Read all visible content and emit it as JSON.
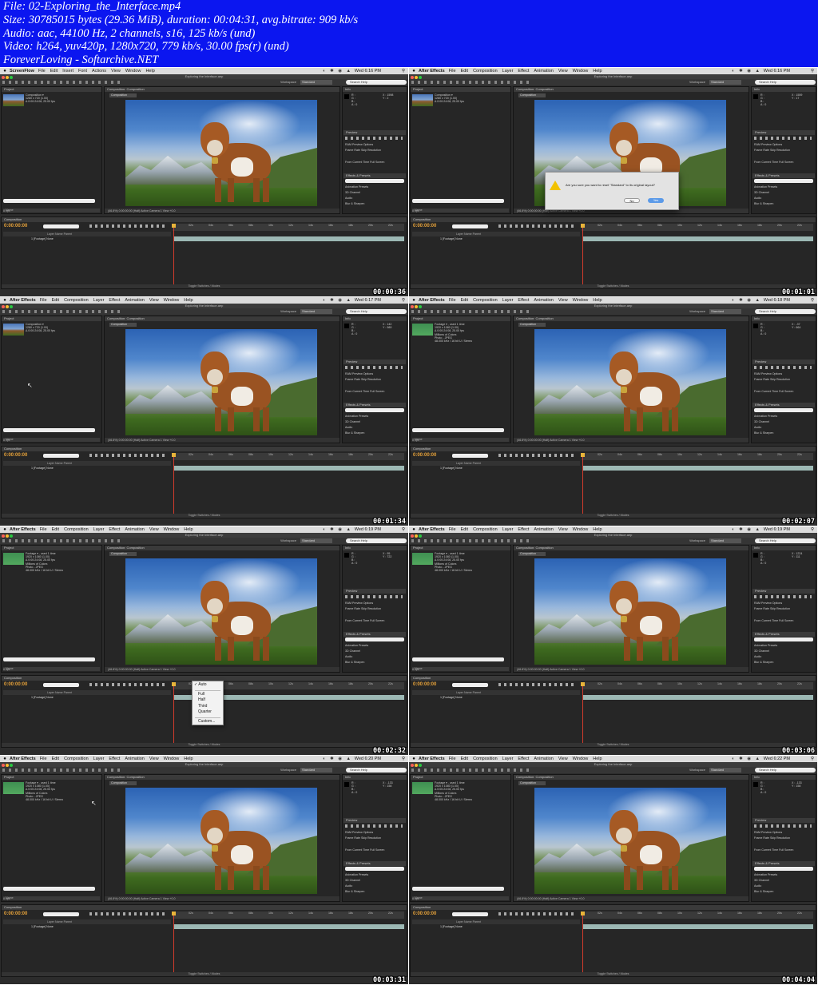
{
  "header": {
    "lines": [
      "File: 02-Exploring_the_Interface.mp4",
      "Size: 30785015 bytes (29.36 MiB), duration: 00:04:31, avg.bitrate: 909 kb/s",
      "Audio: aac, 44100 Hz, 2 channels, s16, 125 kb/s (und)",
      "Video: h264, yuv420p, 1280x720, 779 kb/s, 30.00 fps(r) (und)",
      "ForeverLoving - Softarchive.NET"
    ]
  },
  "colors": {
    "header_bg": "#0b16f0",
    "timecode": "#e8a33a",
    "playhead": "#d23b2c",
    "layer_bar": "#9cb8b4"
  },
  "common": {
    "window_title": "Exploring the Interface.aep",
    "workspace_label": "Workspace",
    "workspace_value": "Standard",
    "search_help": "Search Help",
    "project_tab": "Project",
    "composition_tab": "Composition: Composition",
    "comp_subtab": "Composition",
    "info_tab": "Info",
    "audio_tab": "Audio",
    "preview_tab": "Preview",
    "ram_preview": "RAM Preview Options",
    "frame_rate_line": "Frame Rate  Skip  Resolution",
    "from_current": "From Current Time   Full Screen",
    "effects_tab": "Effects & Presets",
    "effects_items": [
      "Animation Presets",
      "3D Channel",
      "Audio",
      "Blur & Sharpen"
    ],
    "name_col": "Name",
    "project_items": [
      "Composition",
      "Footage"
    ],
    "project_bottom": "8 bpc",
    "comp_footer": "(46.8%)   0:00:00:00   (Half)   Active Camera   1 View   +0.0",
    "timeline_tab": "Composition",
    "timecode": "0:00:00:00",
    "ruler_ticks": [
      "02s",
      "04s",
      "06s",
      "08s",
      "10s",
      "12s",
      "14s",
      "16s",
      "18s",
      "20s",
      "22s"
    ],
    "layer_header": "Layer Name          Parent",
    "layer_row": "1   [Footage]                None",
    "timeline_footer": "Toggle Switches / Modes",
    "rgb": "R :\nG :\nB :\nA : 0",
    "comp_info": "Composition ▾\n1280 x 720 (1.00)\nΔ 0:00:24:08, 25.00 fps",
    "footage_info": "Footage ▾ , used 1 time\n1920 x 1080 (1.00)\nΔ 0:00:24:08, 25.00 fps\nMillions of Colors\nPhoto - JPEG\n48.000 kHz / 16 bit U / Stereo"
  },
  "frames": [
    {
      "timestamp": "00:00:36",
      "app": "ScreenFlow",
      "menus": [
        "File",
        "Edit",
        "Insert",
        "Font",
        "Actions",
        "View",
        "Window",
        "Help"
      ],
      "clock": "Wed 6:16 PM",
      "info": "comp",
      "xy": "X : 1598\nY : 2",
      "selected": 0
    },
    {
      "timestamp": "00:01:01",
      "app": "After Effects",
      "menus": [
        "File",
        "Edit",
        "Composition",
        "Layer",
        "Effect",
        "Animation",
        "View",
        "Window",
        "Help"
      ],
      "clock": "Wed 6:16 PM",
      "info": "comp",
      "xy": "X : 1559\nY : 17",
      "selected": 0
    },
    {
      "timestamp": "00:01:34",
      "app": "After Effects",
      "menus": [
        "File",
        "Edit",
        "Composition",
        "Layer",
        "Effect",
        "Animation",
        "View",
        "Window",
        "Help"
      ],
      "clock": "Wed 6:17 PM",
      "info": "comp",
      "xy": "X : 142\nY : 989",
      "selected": 0
    },
    {
      "timestamp": "00:02:07",
      "app": "After Effects",
      "menus": [
        "File",
        "Edit",
        "Composition",
        "Layer",
        "Effect",
        "Animation",
        "View",
        "Window",
        "Help"
      ],
      "clock": "Wed 6:18 PM",
      "info": "footage",
      "xy": "X : -37\nY : 664",
      "selected": 1
    },
    {
      "timestamp": "00:02:32",
      "app": "After Effects",
      "menus": [
        "File",
        "Edit",
        "Composition",
        "Layer",
        "Effect",
        "Animation",
        "View",
        "Window",
        "Help"
      ],
      "clock": "Wed 6:19 PM",
      "info": "footage",
      "xy": "X : 95\nY : 722",
      "selected": 1
    },
    {
      "timestamp": "00:03:06",
      "app": "After Effects",
      "menus": [
        "File",
        "Edit",
        "Composition",
        "Layer",
        "Effect",
        "Animation",
        "View",
        "Window",
        "Help"
      ],
      "clock": "Wed 6:19 PM",
      "info": "footage",
      "xy": "X : 1224\nY : 111",
      "selected": 1
    },
    {
      "timestamp": "00:03:31",
      "app": "After Effects",
      "menus": [
        "File",
        "Edit",
        "Composition",
        "Layer",
        "Effect",
        "Animation",
        "View",
        "Window",
        "Help"
      ],
      "clock": "Wed 6:20 PM",
      "info": "footage",
      "xy": "X : -133\nY : 158",
      "selected": 1
    },
    {
      "timestamp": "00:04:04",
      "app": "After Effects",
      "menus": [
        "File",
        "Edit",
        "Composition",
        "Layer",
        "Effect",
        "Animation",
        "View",
        "Window",
        "Help"
      ],
      "clock": "Wed 6:22 PM",
      "info": "footage",
      "xy": "X : -133\nY : 158",
      "selected": 1
    }
  ],
  "dialog": {
    "message": "Are you sure you want to reset \"Standard\" to its original layout?",
    "no_label": "No",
    "yes_label": "Yes"
  },
  "resolution_menu": {
    "items": [
      "Auto",
      "Full",
      "Half",
      "Third",
      "Quarter",
      "Custom..."
    ],
    "checked": "Auto"
  }
}
